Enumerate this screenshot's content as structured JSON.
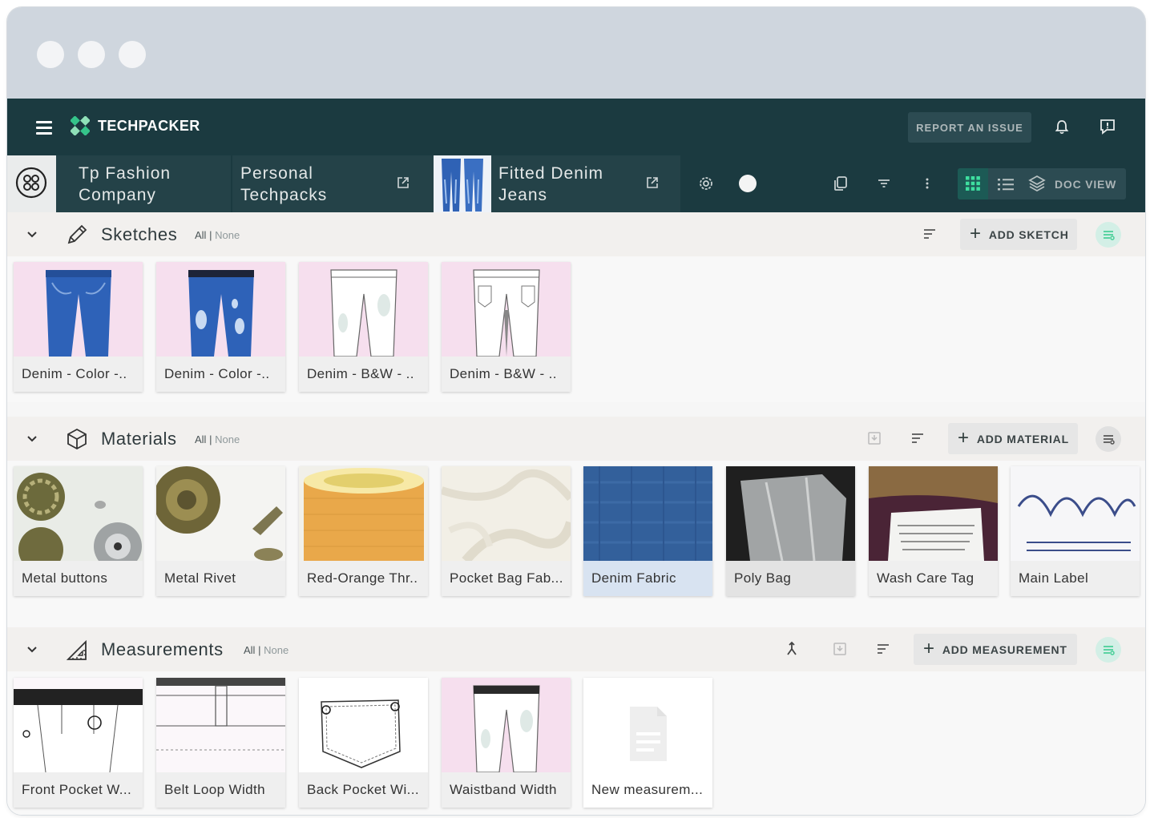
{
  "app": {
    "brand": "TECHPACKER",
    "report_label": "REPORT AN ISSUE"
  },
  "breadcrumb": {
    "company_line1": "Tp Fashion",
    "company_line2": "Company",
    "folder_line1": "Personal",
    "folder_line2": "Techpacks",
    "product_line1": "Fitted Denim",
    "product_line2": "Jeans"
  },
  "toolbar": {
    "doc_view_label": "DOC VIEW"
  },
  "colors": {
    "topbar": "#1b3a40",
    "accent_green": "#35c48a",
    "card_label_bg": "#eeeeee"
  },
  "filter": {
    "all": "All",
    "separator": "|",
    "none": "None"
  },
  "sketches": {
    "title": "Sketches",
    "add_label": "ADD SKETCH",
    "items": [
      {
        "label": "Denim - Color -..",
        "kind": "denim"
      },
      {
        "label": "Denim - Color -..",
        "kind": "denim-ripped"
      },
      {
        "label": "Denim - B&W - ..",
        "kind": "white-ripped"
      },
      {
        "label": "Denim - B&W - ..",
        "kind": "white"
      }
    ]
  },
  "materials": {
    "title": "Materials",
    "add_label": "ADD MATERIAL",
    "items": [
      {
        "label": "Metal buttons",
        "kind": "buttons"
      },
      {
        "label": "Metal Rivet",
        "kind": "rivet"
      },
      {
        "label": "Red-Orange Thr..",
        "kind": "thread"
      },
      {
        "label": "Pocket Bag Fab...",
        "kind": "fabric"
      },
      {
        "label": "Denim Fabric",
        "kind": "denimfabric"
      },
      {
        "label": "Poly Bag",
        "kind": "polybag"
      },
      {
        "label": "Wash Care Tag",
        "kind": "tag"
      },
      {
        "label": "Main Label",
        "kind": "label"
      }
    ]
  },
  "measurements": {
    "title": "Measurements",
    "add_label": "ADD MEASUREMENT",
    "items": [
      {
        "label": "Front Pocket W...",
        "kind": "frontpocket"
      },
      {
        "label": "Belt Loop Width",
        "kind": "beltloop"
      },
      {
        "label": "Back Pocket Wi...",
        "kind": "backpocket"
      },
      {
        "label": "Waistband Width",
        "kind": "waistband"
      },
      {
        "label": "New measurem...",
        "kind": "placeholder"
      }
    ]
  }
}
